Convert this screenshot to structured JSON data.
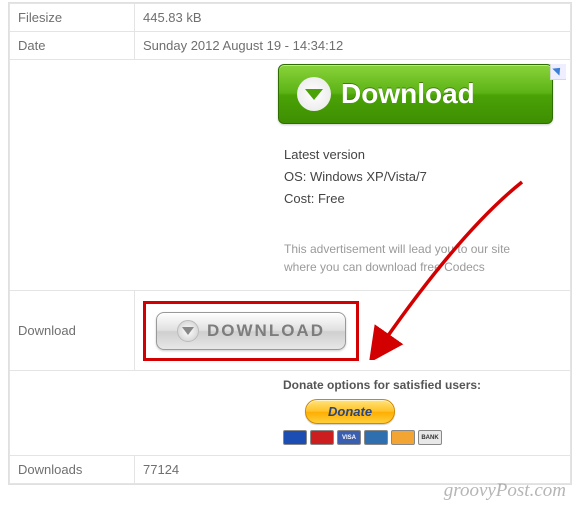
{
  "rows": {
    "filesize": {
      "label": "Filesize",
      "value": "445.83 kB"
    },
    "date": {
      "label": "Date",
      "value": "Sunday 2012 August 19 - 14:34:12"
    },
    "download": {
      "label": "Download",
      "button_text": "DOWNLOAD"
    },
    "downloads": {
      "label": "Downloads",
      "value": "77124"
    }
  },
  "ad": {
    "button_text": "Download",
    "latest": "Latest version",
    "os": "OS: Windows XP/Vista/7",
    "cost": "Cost: Free",
    "note": "This advertisement will lead you to our site where you can download free Codecs"
  },
  "donate": {
    "heading": "Donate options for satisfied users:",
    "button": "Donate",
    "cards": [
      "Maestro",
      "MC",
      "VISA",
      "AMEX",
      "DISC",
      "BANK"
    ]
  },
  "watermark": "groovyPost.com"
}
